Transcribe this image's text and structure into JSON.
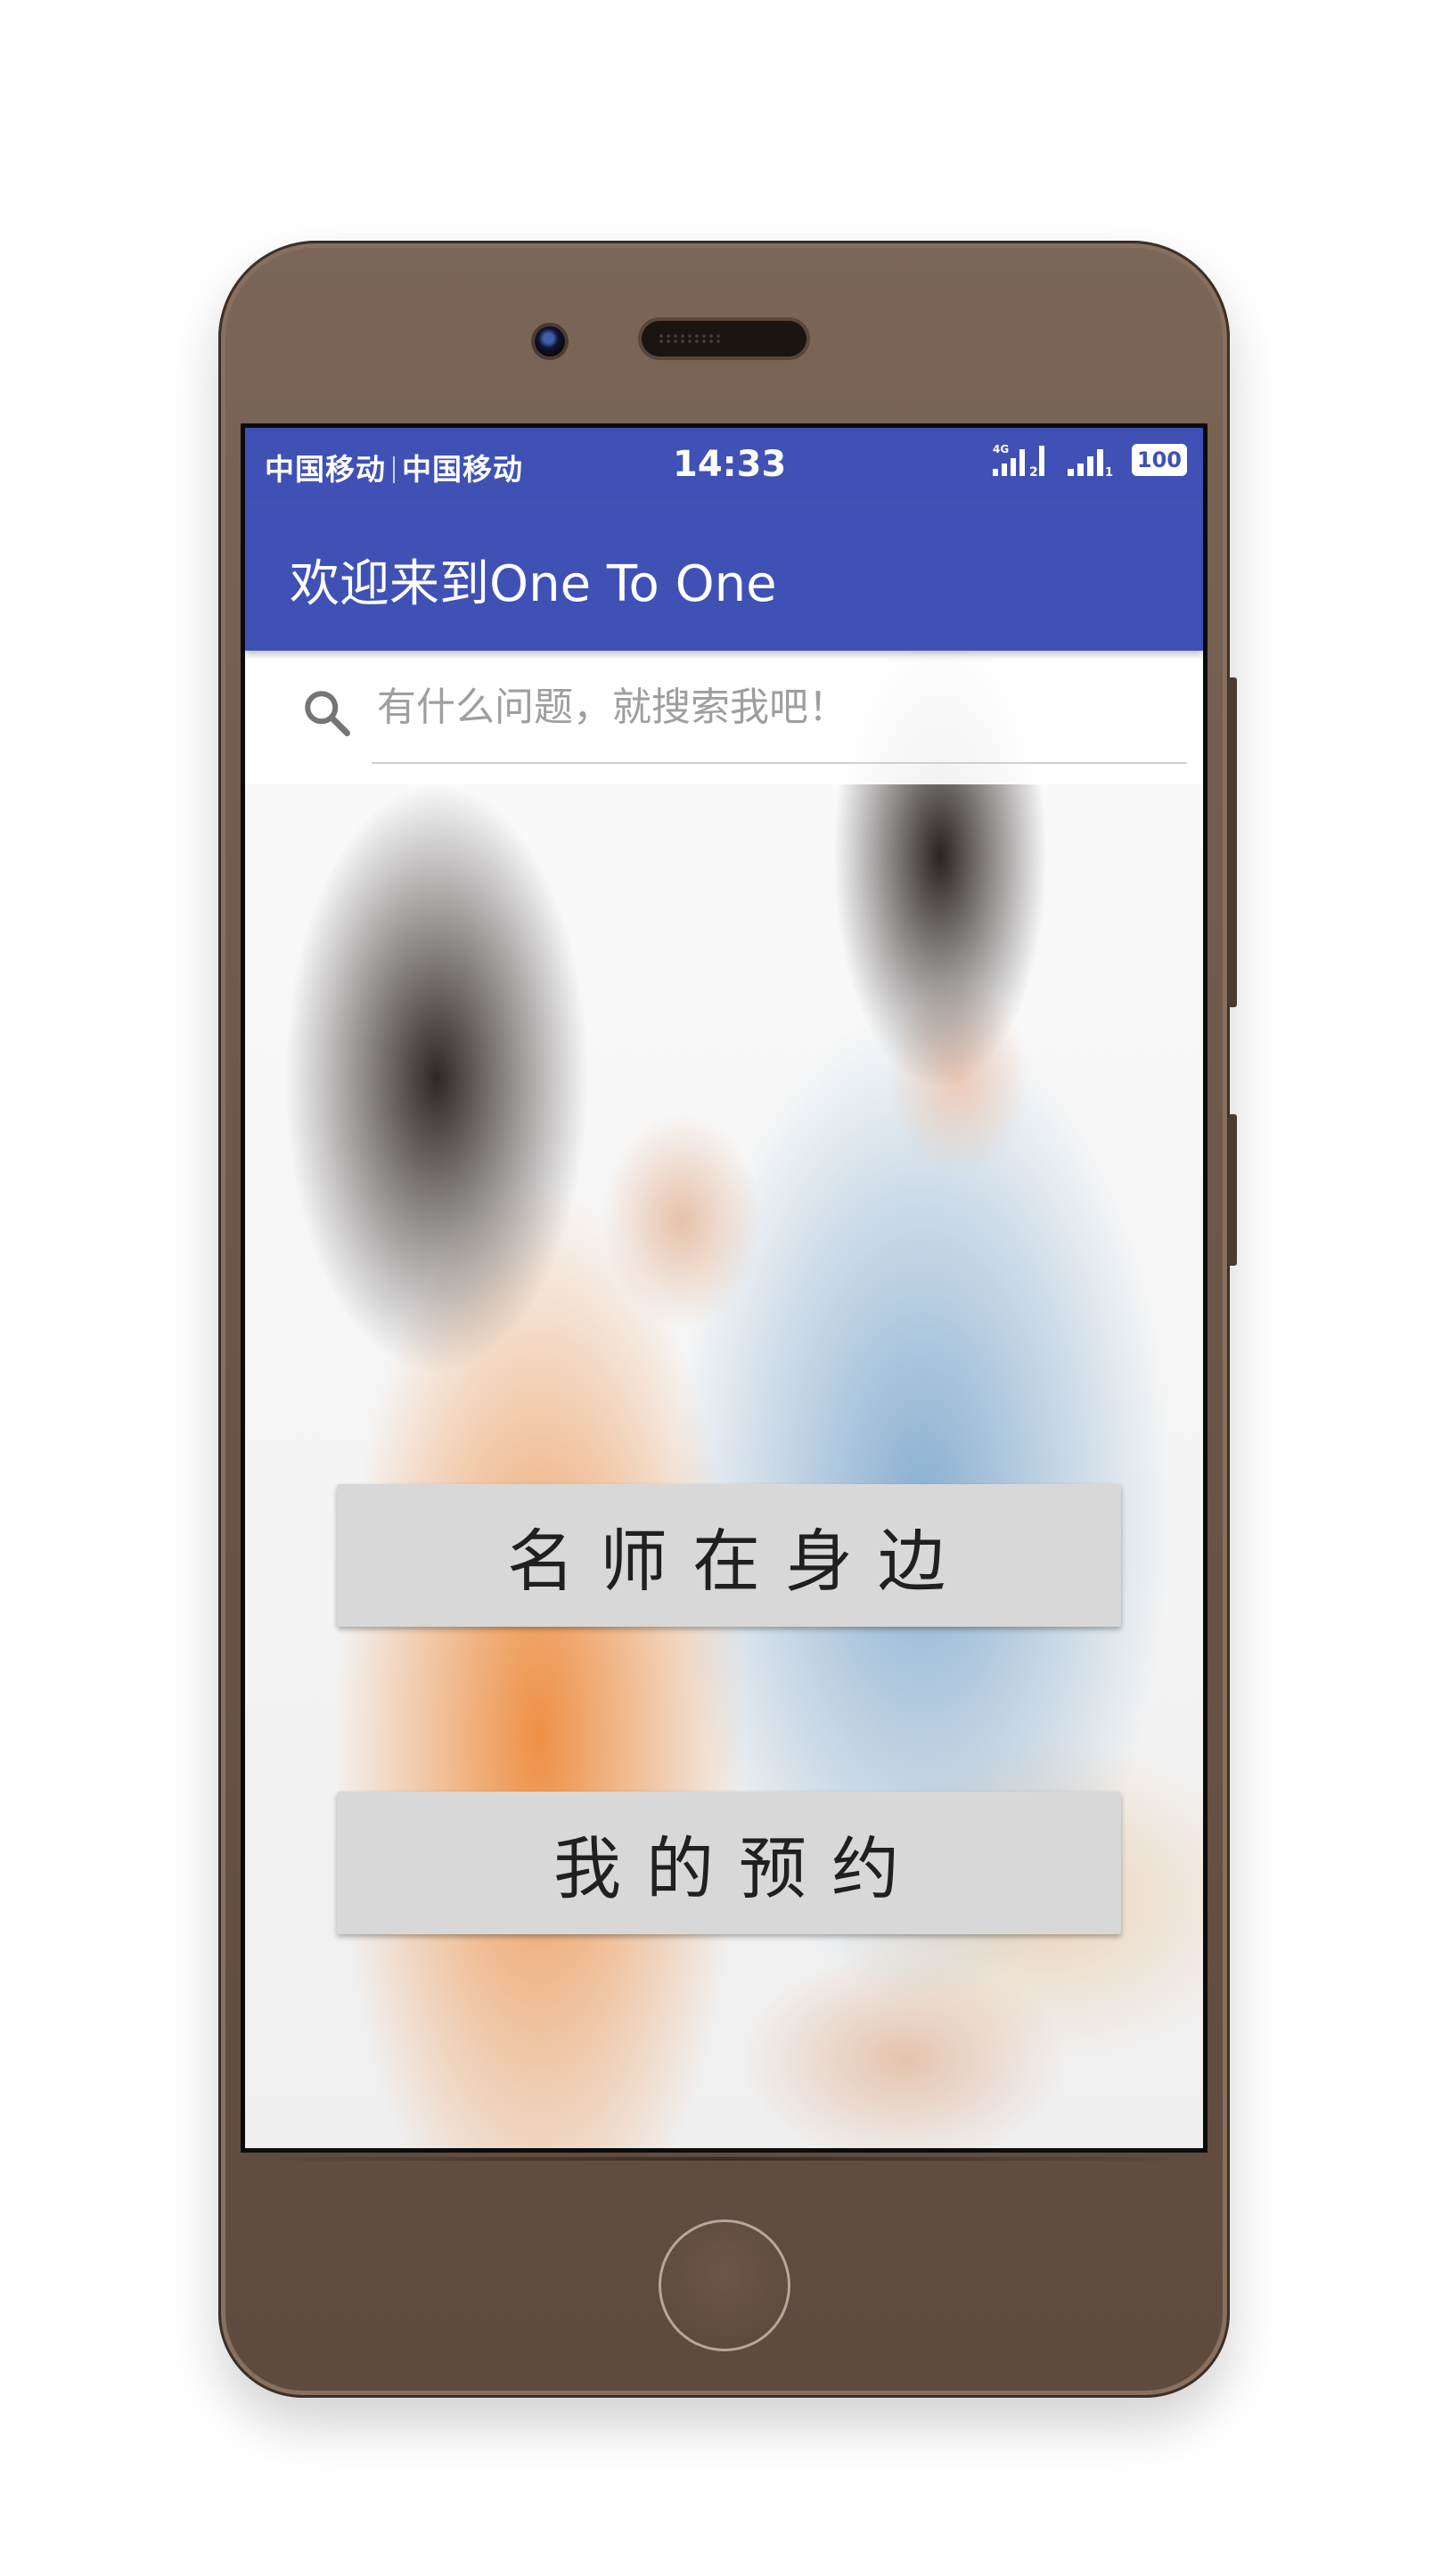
{
  "status_bar": {
    "carrier_1": "中国移动",
    "carrier_2": "中国移动",
    "time": "14:33",
    "network_label": "4G",
    "battery": "100",
    "background_color": "#3f51b5"
  },
  "app_bar": {
    "title": "欢迎来到One To One",
    "color": "#3f51b5"
  },
  "search": {
    "icon": "search-icon",
    "placeholder": "有什么问题，就搜索我吧！",
    "value": ""
  },
  "buttons": {
    "famous_teacher": "名师在身边",
    "my_appointments": "我的预约"
  },
  "device": {
    "body_color": "#6d5749"
  }
}
